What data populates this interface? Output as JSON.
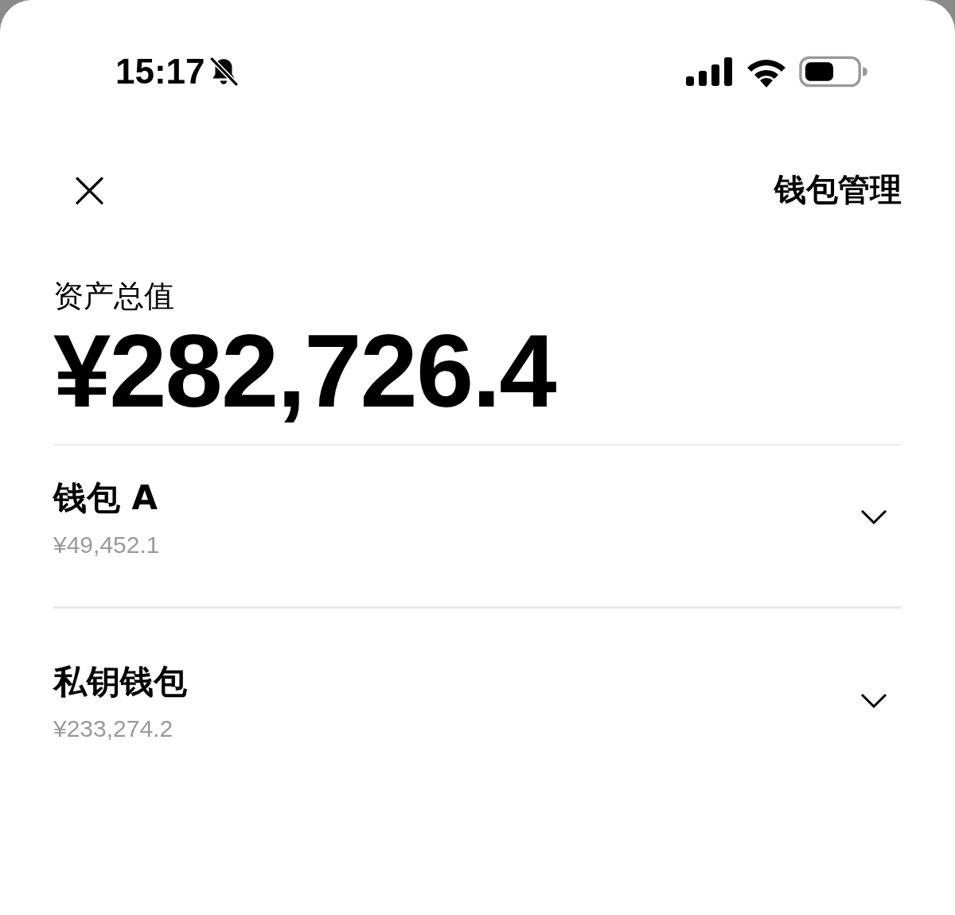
{
  "status_bar": {
    "time": "15:17",
    "silent": true
  },
  "header": {
    "close": "×",
    "manage": "钱包管理"
  },
  "total": {
    "label": "资产总值",
    "amount": "¥282,726.4"
  },
  "wallets": [
    {
      "name": "钱包 A",
      "value": "¥49,452.1",
      "expanded": false
    },
    {
      "name": "私钥钱包",
      "value": "¥233,274.2",
      "expanded": false
    }
  ]
}
